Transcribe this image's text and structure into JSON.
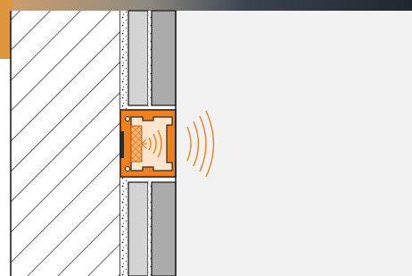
{
  "diagram": {
    "subject": "wall-profile-cross-section",
    "components": {
      "background_photo": "background-photo",
      "wall_substrate": "hatched-wall-substrate",
      "tile_adhesive": "speckled-tile-adhesive-layer",
      "tiles_upper": "tile-upper",
      "tiles_lower": "tile-lower",
      "led_profile": "orange-led-profile",
      "led_strip": "led-strip",
      "light_emission": "light-wave-icon"
    },
    "colors": {
      "profile_orange": "#f07f1e",
      "profile_dark": "#2b2b2b",
      "wall_surface": "#f2f2f2",
      "tile_light": "#d4d4d4",
      "tile_dark": "#ababab",
      "substrate_bg": "#ffffff",
      "photo_tint": "#3a4350"
    }
  }
}
